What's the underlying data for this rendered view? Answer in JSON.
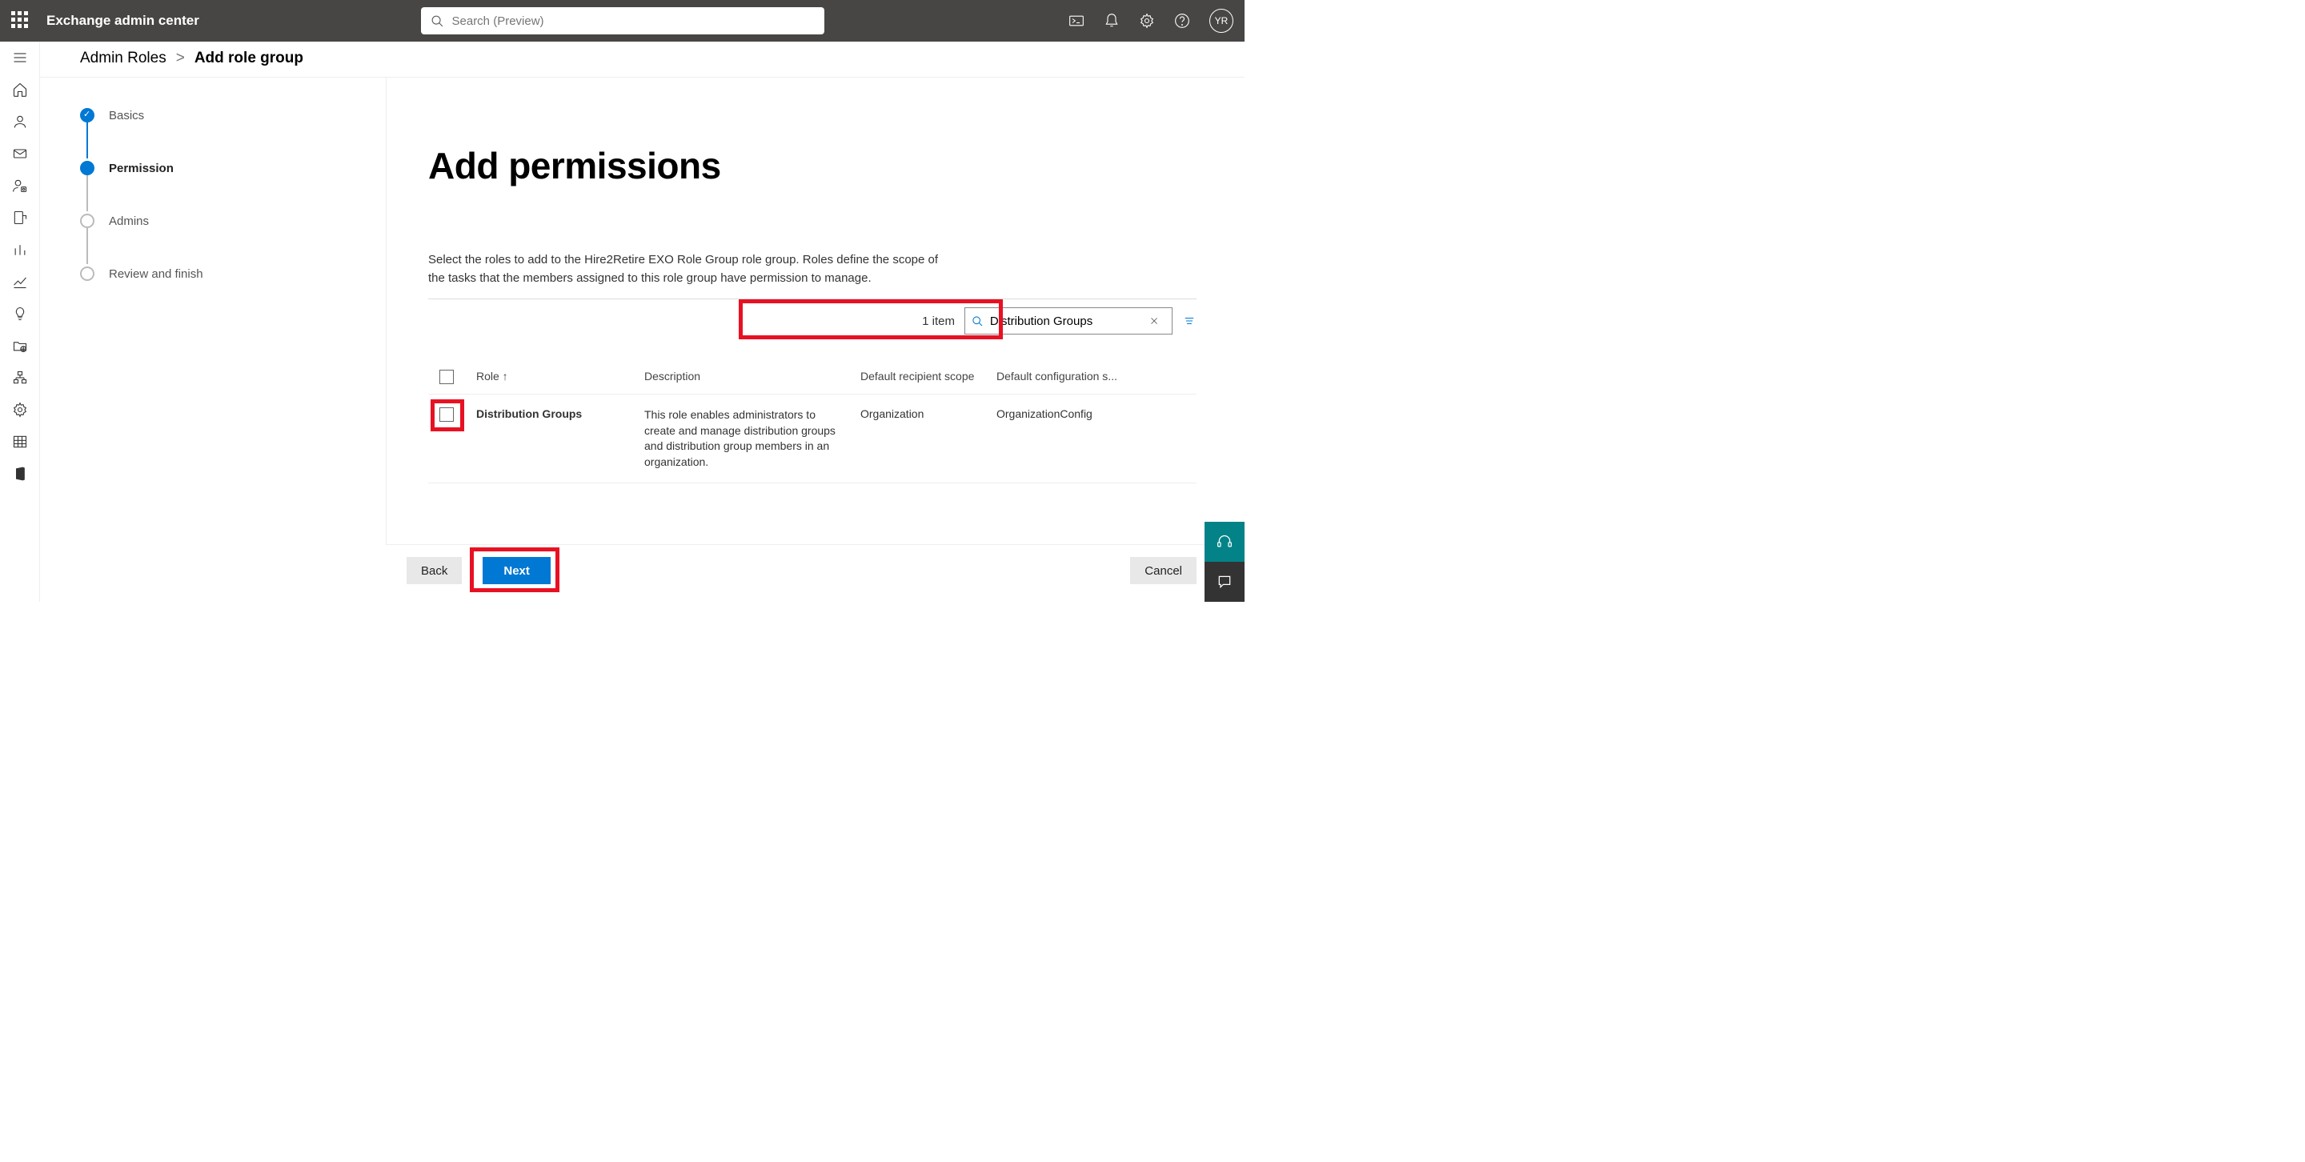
{
  "header": {
    "app_title": "Exchange admin center",
    "search_placeholder": "Search (Preview)",
    "avatar_initials": "YR"
  },
  "breadcrumb": {
    "parent": "Admin Roles",
    "separator": ">",
    "current": "Add role group"
  },
  "stepper": {
    "steps": [
      {
        "label": "Basics",
        "state": "done"
      },
      {
        "label": "Permission",
        "state": "active"
      },
      {
        "label": "Admins",
        "state": "pending"
      },
      {
        "label": "Review and finish",
        "state": "pending"
      }
    ]
  },
  "main": {
    "heading": "Add permissions",
    "description": "Select the roles to add to the Hire2Retire EXO Role Group role group. Roles define the scope of the tasks that the members assigned to this role group have permission to manage.",
    "item_count_label": "1 item",
    "filter_value": "Distribution Groups",
    "columns": {
      "role": "Role",
      "description": "Description",
      "scope": "Default recipient scope",
      "config": "Default configuration s..."
    },
    "rows": [
      {
        "role": "Distribution Groups",
        "description": "This role enables administrators to create and manage distribution groups and distribution group members in an organization.",
        "scope": "Organization",
        "config": "OrganizationConfig"
      }
    ]
  },
  "footer": {
    "back": "Back",
    "next": "Next",
    "cancel": "Cancel"
  }
}
